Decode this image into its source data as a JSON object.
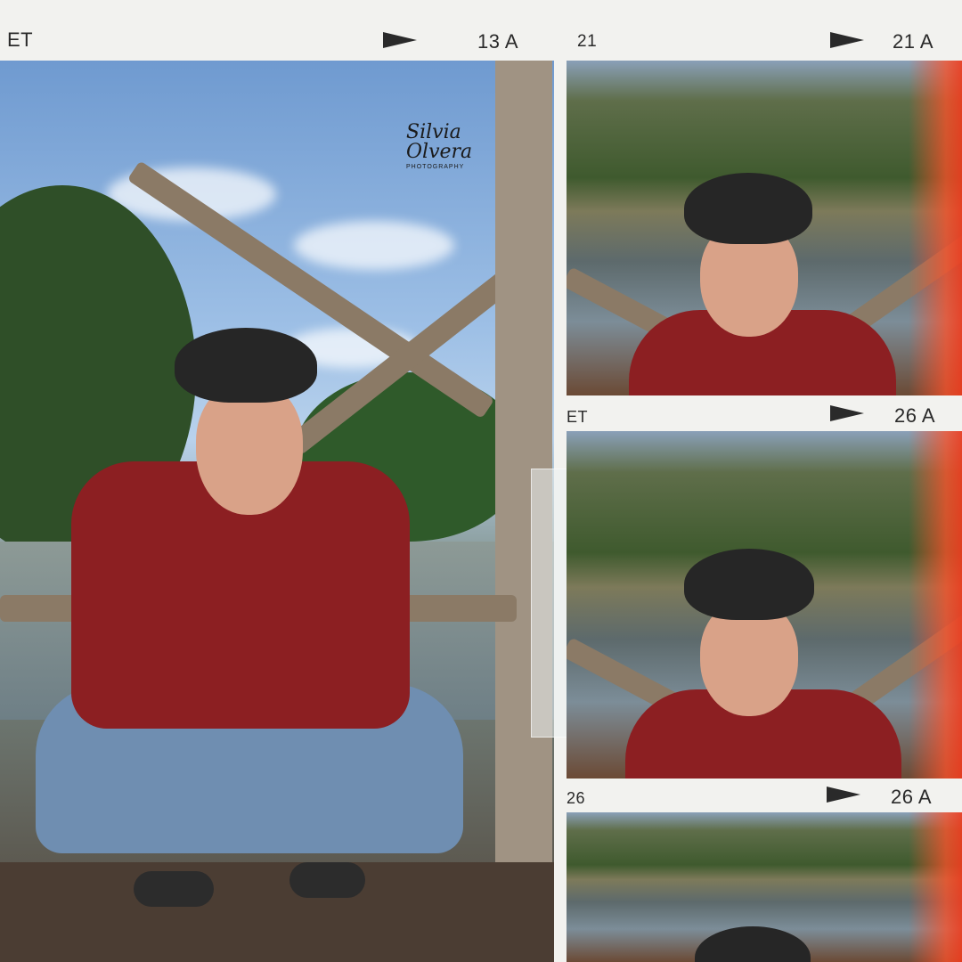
{
  "frames": {
    "top_left_label": "ET",
    "top_left_frame": "13 A",
    "top_right_left_label": "21",
    "top_right_frame": "21 A",
    "mid_left_label": "ET",
    "mid_frame": "26 A",
    "bottom_left_label": "26",
    "bottom_frame": "26 A"
  },
  "watermark": {
    "line1": "Silvia",
    "line2": "Olvera",
    "line3": "PHOTOGRAPHY"
  },
  "colors": {
    "film_border": "#f2f2ef",
    "light_leak": "#f04a22",
    "shirt": "#8c1f22",
    "hat": "#262626"
  }
}
